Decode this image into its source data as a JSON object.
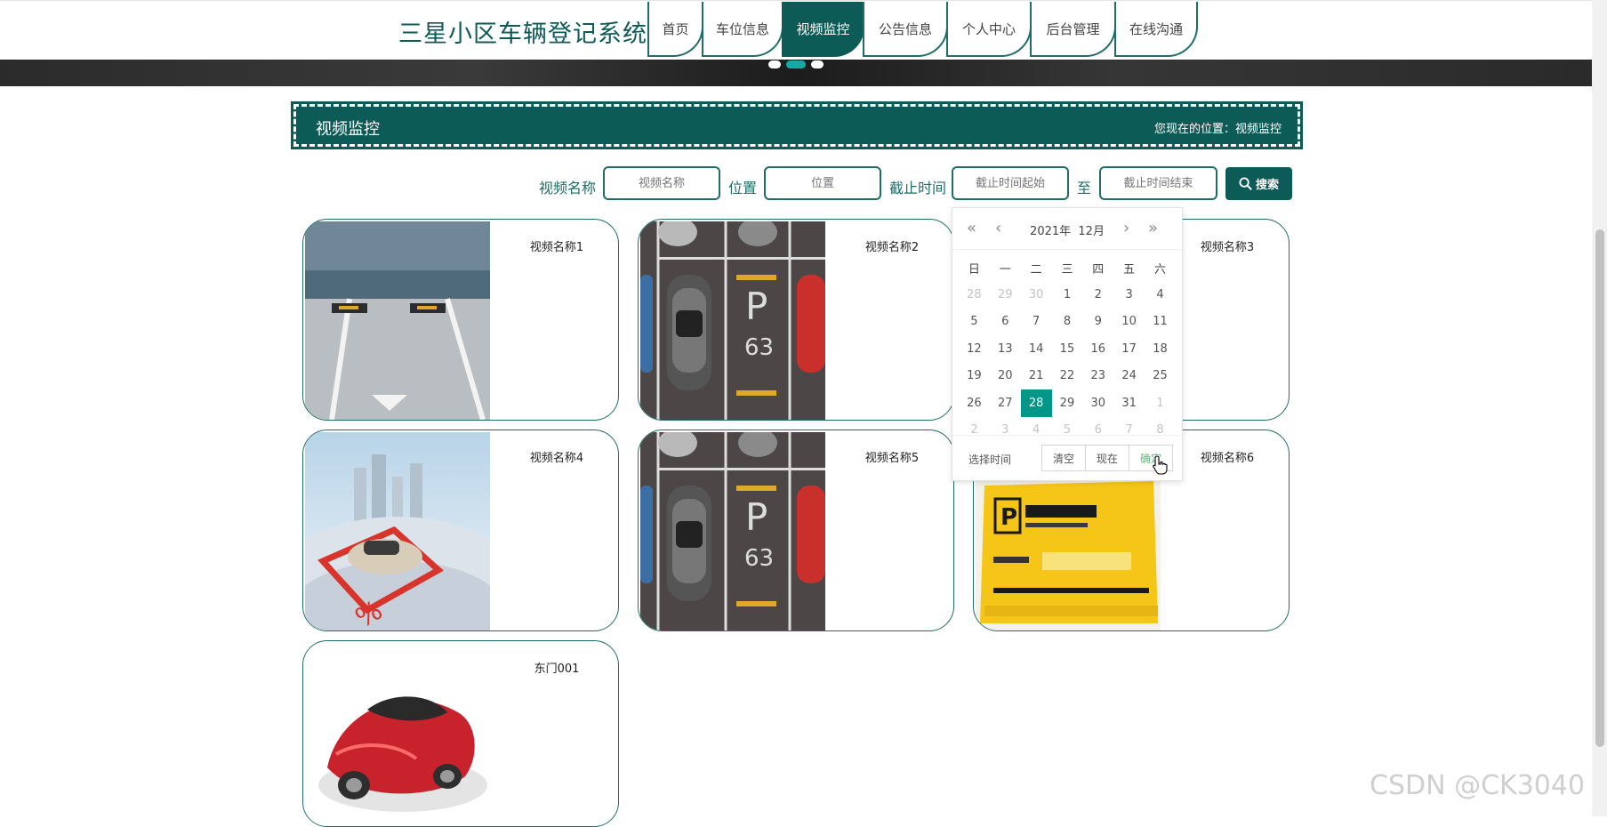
{
  "site": {
    "title": "三星小区车辆登记系统"
  },
  "nav": [
    {
      "label": "首页",
      "active": false
    },
    {
      "label": "车位信息",
      "active": false
    },
    {
      "label": "视频监控",
      "active": true
    },
    {
      "label": "公告信息",
      "active": false
    },
    {
      "label": "个人中心",
      "active": false
    },
    {
      "label": "后台管理",
      "active": false
    },
    {
      "label": "在线沟通",
      "active": false
    }
  ],
  "carousel": {
    "count": 3,
    "active_index": 1
  },
  "section": {
    "title": "视频监控",
    "breadcrumb": "您现在的位置：视频监控"
  },
  "search": {
    "name_label": "视频名称",
    "name_placeholder": "视频名称",
    "position_label": "位置",
    "position_placeholder": "位置",
    "deadline_label": "截止时间",
    "start_placeholder": "截止时间起始",
    "to_label": "至",
    "end_placeholder": "截止时间结束",
    "button_label": "搜索"
  },
  "cards": [
    {
      "name": "视频名称1",
      "image": "parking-garage-photo"
    },
    {
      "name": "视频名称2",
      "image": "parking-lot-aerial-photo"
    },
    {
      "name": "视频名称3",
      "image": "hidden-by-calendar"
    },
    {
      "name": "视频名称4",
      "image": "car-on-snow-photo"
    },
    {
      "name": "视频名称5",
      "image": "parking-lot-aerial-photo"
    },
    {
      "name": "视频名称6",
      "image": "reserved-parking-sign-photo"
    },
    {
      "name": "东门001",
      "image": "red-sports-car-photo"
    }
  ],
  "calendar": {
    "year": "2021年",
    "month": "12月",
    "weekdays": [
      "日",
      "一",
      "二",
      "三",
      "四",
      "五",
      "六"
    ],
    "weeks": [
      [
        "28",
        "29",
        "30",
        "1",
        "2",
        "3",
        "4"
      ],
      [
        "5",
        "6",
        "7",
        "8",
        "9",
        "10",
        "11"
      ],
      [
        "12",
        "13",
        "14",
        "15",
        "16",
        "17",
        "18"
      ],
      [
        "19",
        "20",
        "21",
        "22",
        "23",
        "24",
        "25"
      ],
      [
        "26",
        "27",
        "28",
        "29",
        "30",
        "31",
        "1"
      ],
      [
        "2",
        "3",
        "4",
        "5",
        "6",
        "7",
        "8"
      ]
    ],
    "selected": "28",
    "select_time_label": "选择时间",
    "clear_label": "清空",
    "now_label": "现在",
    "confirm_label": "确定",
    "accent": "#009688"
  },
  "colors": {
    "primary": "#0d5b57",
    "accent": "#16a9a6"
  },
  "watermark": "CSDN @CK3040"
}
